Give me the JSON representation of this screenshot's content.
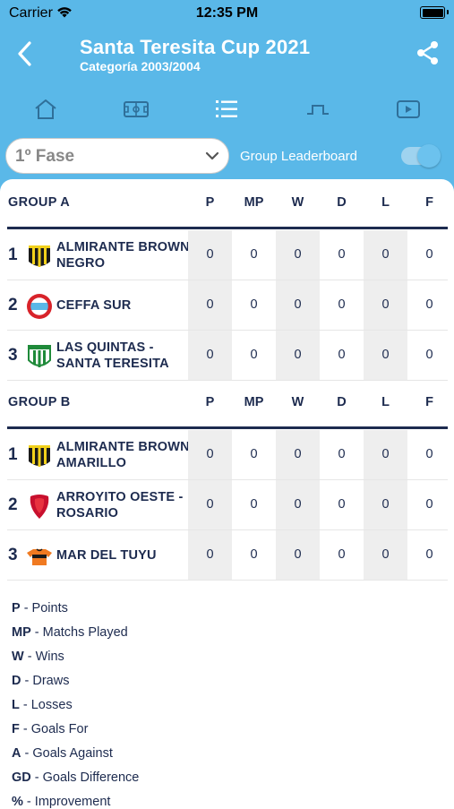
{
  "status": {
    "carrier": "Carrier",
    "time": "12:35 PM"
  },
  "header": {
    "title": "Santa Teresita Cup 2021",
    "subtitle": "Categoría 2003/2004"
  },
  "tabs": [
    {
      "icon": "home-icon"
    },
    {
      "icon": "field-icon"
    },
    {
      "icon": "list-icon",
      "active": true
    },
    {
      "icon": "goal-icon"
    },
    {
      "icon": "video-icon"
    }
  ],
  "filters": {
    "phase": "1º Fase",
    "toggle_label": "Group Leaderboard",
    "toggle_on": true
  },
  "columns": [
    "P",
    "MP",
    "W",
    "D",
    "L",
    "F"
  ],
  "groups": [
    {
      "name": "GROUP A",
      "rows": [
        {
          "pos": "1",
          "team_line1": "ALMIRANTE BROWN",
          "team_line2": "NEGRO",
          "stats": [
            "0",
            "0",
            "0",
            "0",
            "0",
            "0"
          ]
        },
        {
          "pos": "2",
          "team_line1": "CEFFA SUR",
          "team_line2": "",
          "stats": [
            "0",
            "0",
            "0",
            "0",
            "0",
            "0"
          ]
        },
        {
          "pos": "3",
          "team_line1": "LAS QUINTAS -",
          "team_line2": "SANTA TERESITA",
          "stats": [
            "0",
            "0",
            "0",
            "0",
            "0",
            "0"
          ]
        }
      ]
    },
    {
      "name": "GROUP B",
      "rows": [
        {
          "pos": "1",
          "team_line1": "ALMIRANTE BROWN",
          "team_line2": "AMARILLO",
          "stats": [
            "0",
            "0",
            "0",
            "0",
            "0",
            "0"
          ]
        },
        {
          "pos": "2",
          "team_line1": "ARROYITO OESTE -",
          "team_line2": "ROSARIO",
          "stats": [
            "0",
            "0",
            "0",
            "0",
            "0",
            "0"
          ]
        },
        {
          "pos": "3",
          "team_line1": "MAR DEL TUYU",
          "team_line2": "",
          "stats": [
            "0",
            "0",
            "0",
            "0",
            "0",
            "0"
          ]
        }
      ]
    }
  ],
  "legend": [
    {
      "abbr": "P",
      "text": " - Points"
    },
    {
      "abbr": "MP",
      "text": " - Matchs Played"
    },
    {
      "abbr": "W",
      "text": " - Wins"
    },
    {
      "abbr": "D",
      "text": " - Draws"
    },
    {
      "abbr": "L",
      "text": " - Losses"
    },
    {
      "abbr": "F",
      "text": " - Goals For"
    },
    {
      "abbr": "A",
      "text": " - Goals Against"
    },
    {
      "abbr": "GD",
      "text": " - Goals Difference"
    },
    {
      "abbr": "%",
      "text": " - Improvement"
    }
  ],
  "colors": {
    "header_bg": "#5ab8e8",
    "text_dark": "#1d2b4f"
  }
}
